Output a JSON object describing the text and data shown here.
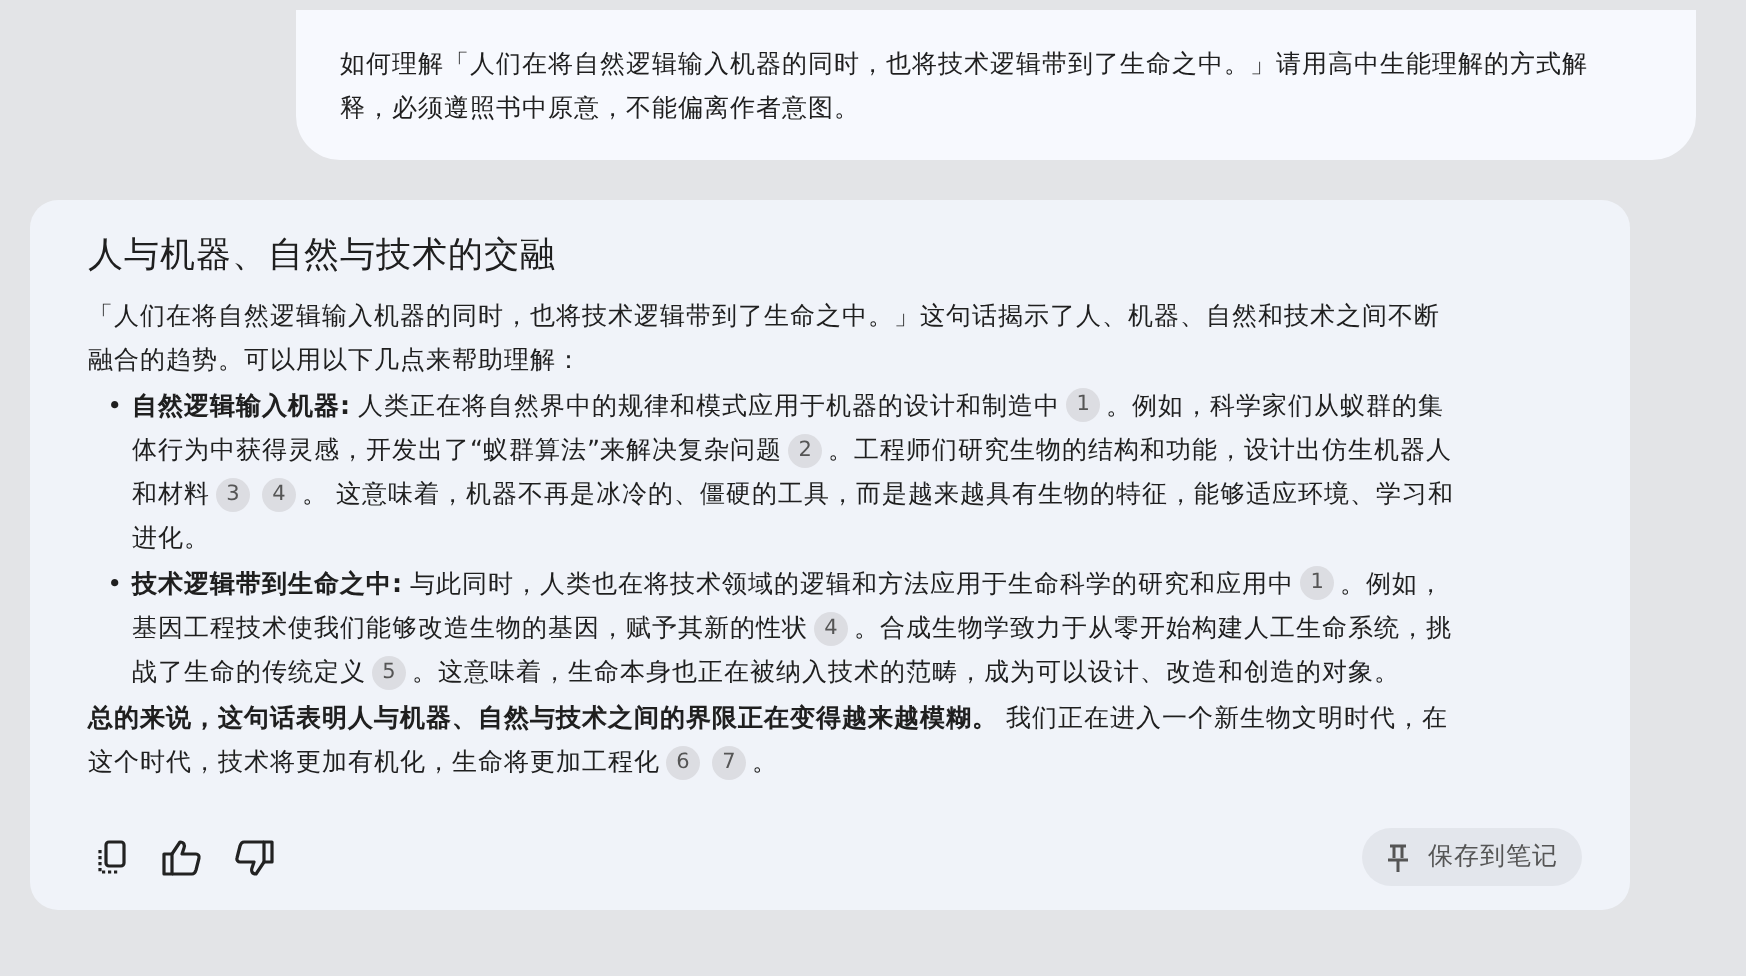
{
  "question": "如何理解「人们在将自然逻辑输入机器的同时，也将技术逻辑带到了生命之中。」请用高中生能理解的方式解释，必须遵照书中原意，不能偏离作者意图。",
  "answer": {
    "title": "人与机器、自然与技术的交融",
    "intro": [
      [
        {
          "text": "「人们在将自然逻辑输入机器的同时，也将技术逻辑带到了生命之中。」这句话揭示了人、机器、自然和技术之间不断"
        }
      ],
      [
        {
          "text": "融合的趋势。可以用以下几点来帮助理解："
        }
      ]
    ],
    "bullets": [
      {
        "marker": "•",
        "lines": [
          [
            {
              "text": "**自然逻辑输入机器:** 人类正在将自然界中的规律和模式应用于机器的设计和制造中"
            },
            {
              "cite": "1"
            },
            {
              "text": "。例如，科学家们从蚁群的集"
            }
          ],
          [
            {
              "text": "体行为中获得灵感，开发出了“蚁群算法”来解决复杂问题"
            },
            {
              "cite": "2"
            },
            {
              "text": "。工程师们研究生物的结构和功能，设计出仿生机器人"
            }
          ],
          [
            {
              "text": "和材料"
            },
            {
              "cite": "3"
            },
            {
              "cite": "4"
            },
            {
              "text": "。 这意味着，机器不再是冰冷的、僵硬的工具，而是越来越具有生物的特征，能够适应环境、学习和"
            }
          ],
          [
            {
              "text": "进化。"
            }
          ]
        ]
      },
      {
        "marker": "•",
        "lines": [
          [
            {
              "text": "**技术逻辑带到生命之中:** 与此同时，人类也在将技术领域的逻辑和方法应用于生命科学的研究和应用中"
            },
            {
              "cite": "1"
            },
            {
              "text": "。例如，"
            }
          ],
          [
            {
              "text": "基因工程技术使我们能够改造生物的基因，赋予其新的性状"
            },
            {
              "cite": "4"
            },
            {
              "text": "。合成生物学致力于从零开始构建人工生命系统，挑"
            }
          ],
          [
            {
              "text": "战了生命的传统定义"
            },
            {
              "cite": "5"
            },
            {
              "text": "。这意味着，生命本身也正在被纳入技术的范畴，成为可以设计、改造和创造的对象。"
            }
          ]
        ]
      }
    ],
    "conclusion": [
      [
        {
          "text": "**总的来说，这句话表明人与机器、自然与技术之间的界限正在变得越来越模糊。** 我们正在进入一个新生物文明时代，在"
        }
      ],
      [
        {
          "text": "这个时代，技术将更加有机化，生命将更加工程化"
        },
        {
          "cite": "6"
        },
        {
          "cite": "7"
        },
        {
          "text": "。"
        }
      ]
    ],
    "save_button": "保存到笔记"
  }
}
